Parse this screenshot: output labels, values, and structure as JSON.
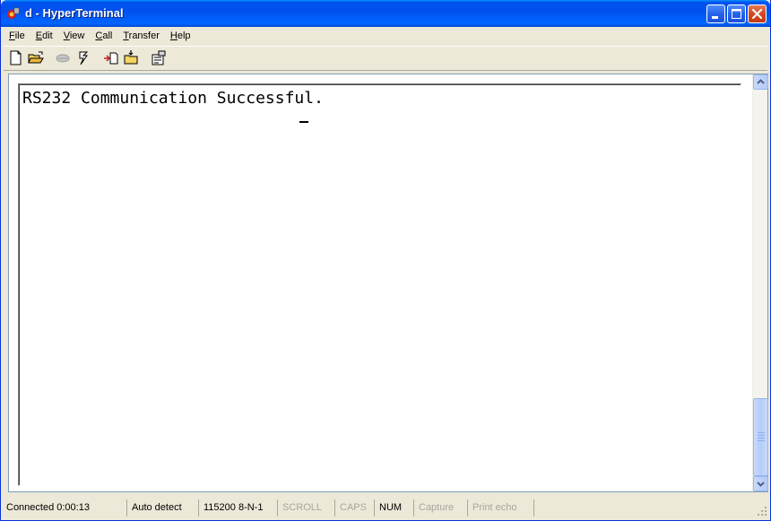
{
  "window": {
    "title": "d - HyperTerminal"
  },
  "menu": [
    {
      "underline": "F",
      "rest": "ile"
    },
    {
      "underline": "E",
      "rest": "dit"
    },
    {
      "underline": "V",
      "rest": "iew"
    },
    {
      "underline": "C",
      "rest": "all"
    },
    {
      "underline": "T",
      "rest": "ransfer"
    },
    {
      "underline": "H",
      "rest": "elp"
    }
  ],
  "toolbar": {
    "buttons": [
      "new-document-icon",
      "open-folder-icon",
      "phone-disconnect-icon",
      "dial-icon",
      "send-icon",
      "receive-icon",
      "properties-icon"
    ]
  },
  "terminal": {
    "output_line": "RS232 Communication Successful."
  },
  "statusbar": {
    "connected": "Connected 0:00:13",
    "detect": "Auto detect",
    "settings": "115200 8-N-1",
    "scroll": "SCROLL",
    "caps": "CAPS",
    "num": "NUM",
    "capture": "Capture",
    "print_echo": "Print echo"
  },
  "colors": {
    "titlebar": "#0053ee",
    "close_button": "#d4471f",
    "chrome": "#ece9d8"
  }
}
